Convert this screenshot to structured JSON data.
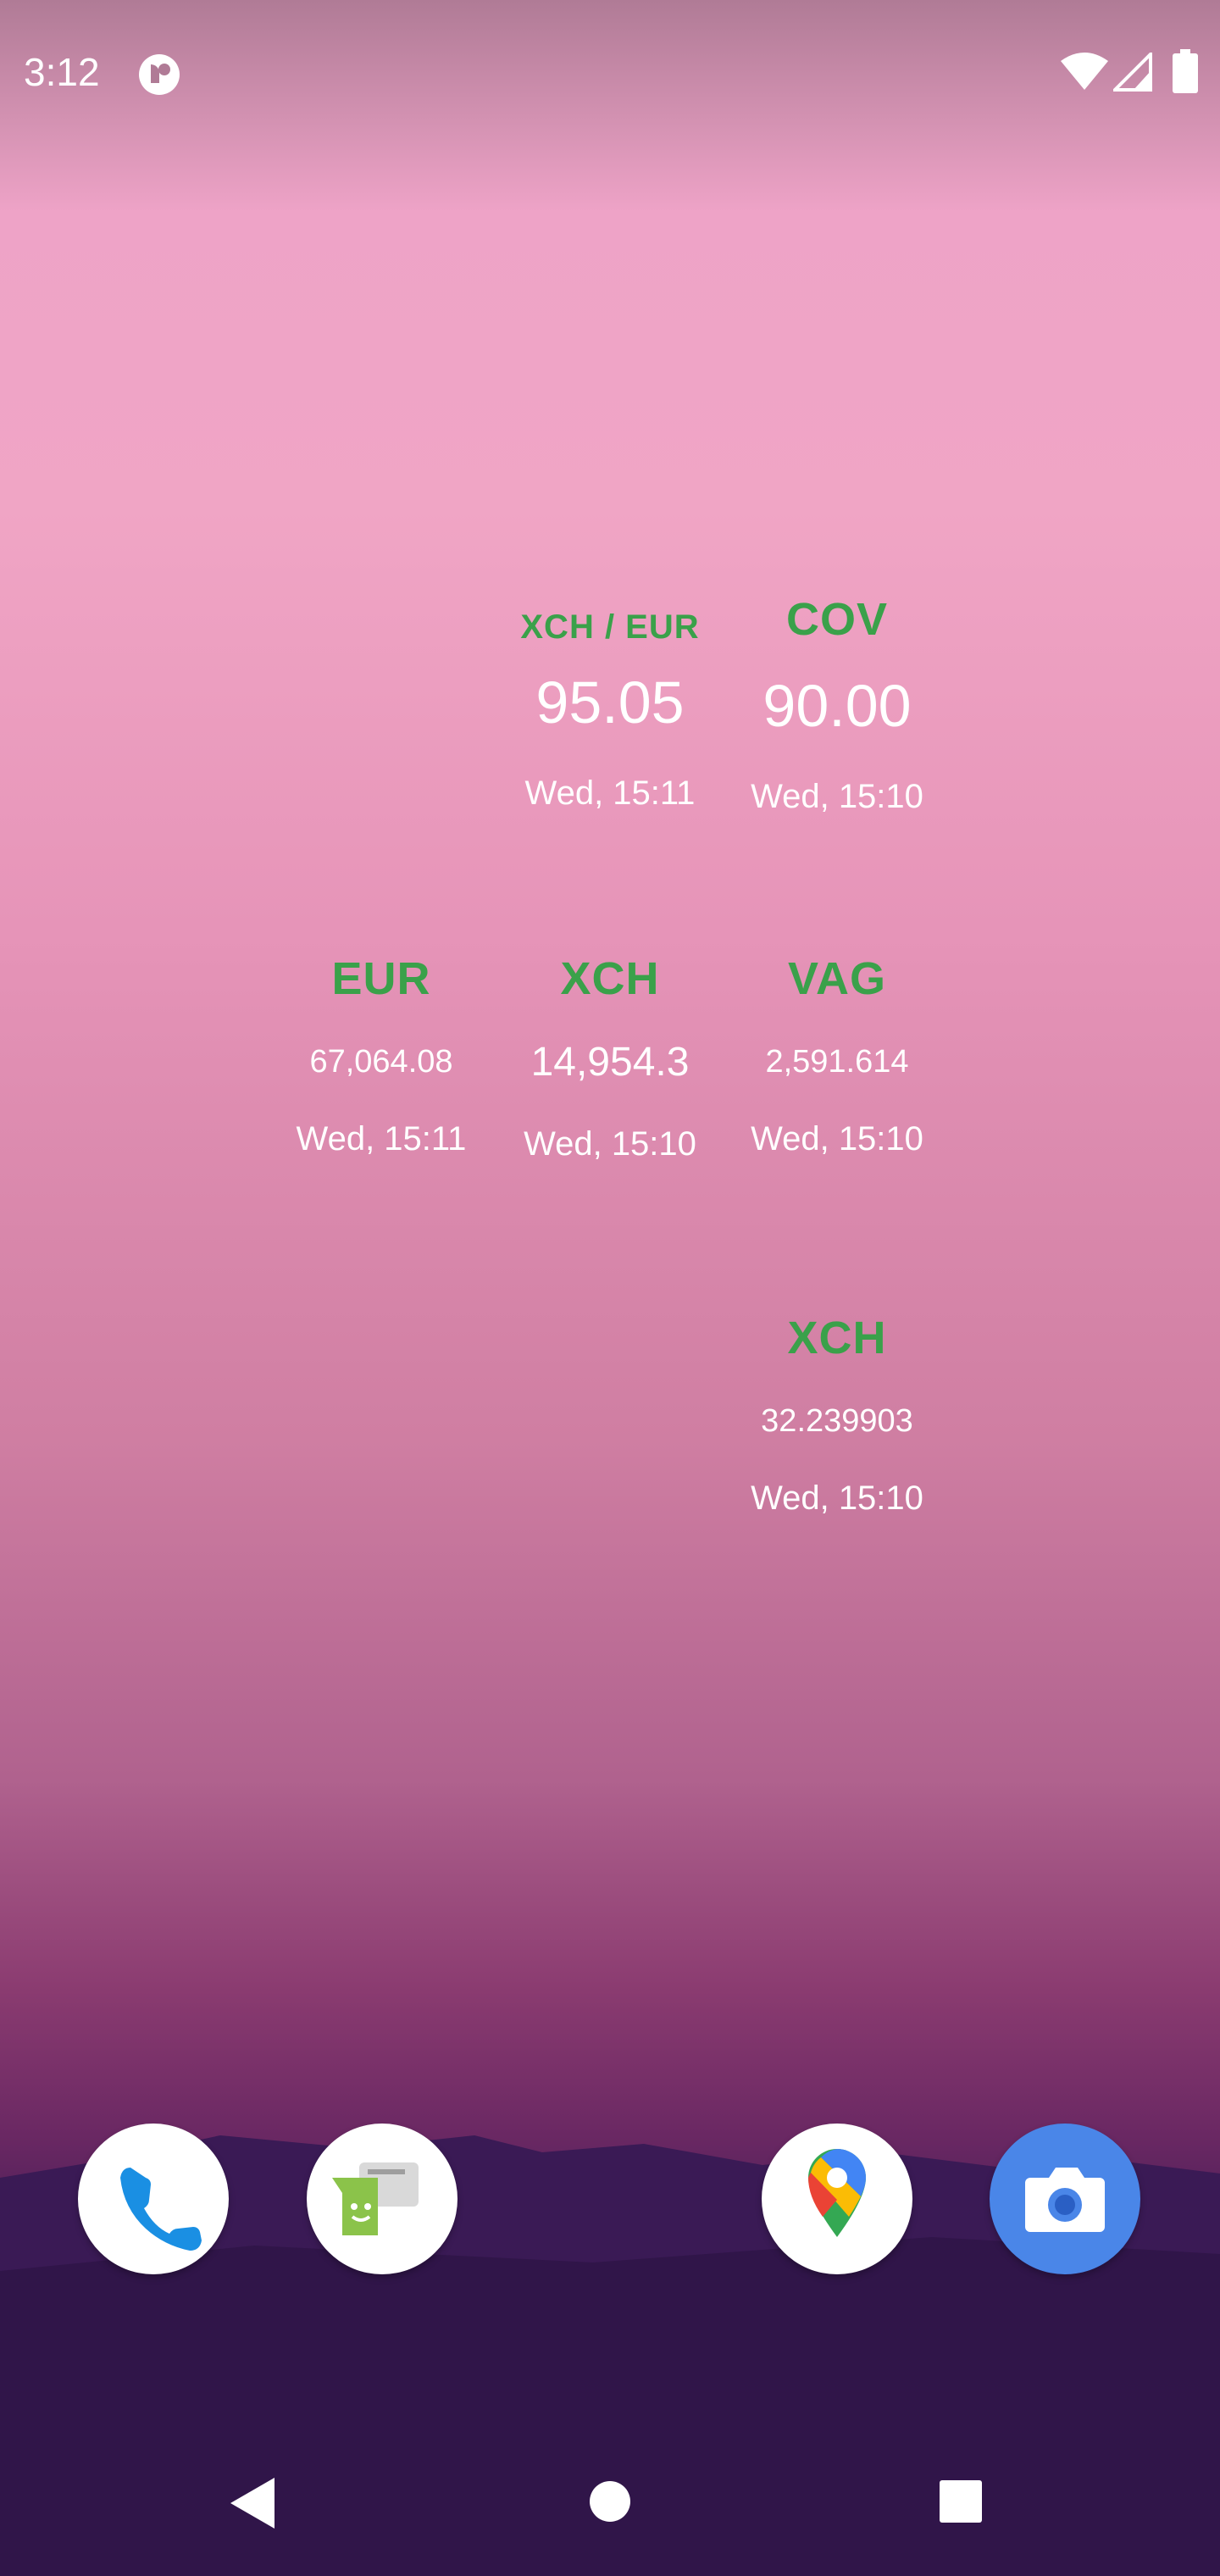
{
  "status_bar": {
    "time": "3:12",
    "icons": [
      "app-notification-icon",
      "wifi-icon",
      "cell-signal-icon",
      "battery-icon"
    ]
  },
  "widgets": {
    "row1": [
      {
        "ticker": "XCH / EUR",
        "price": "95.05",
        "stamp": "Wed, 15:11"
      },
      {
        "ticker": "COV",
        "price": "90.00",
        "stamp": "Wed, 15:10"
      }
    ],
    "row2": [
      {
        "ticker": "EUR",
        "price": "67,064.08",
        "stamp": "Wed, 15:11"
      },
      {
        "ticker": "XCH",
        "price": "14,954.3",
        "stamp": "Wed, 15:10"
      },
      {
        "ticker": "VAG",
        "price": "2,591.614",
        "stamp": "Wed, 15:10"
      }
    ],
    "row3": [
      {
        "ticker": "XCH",
        "price": "32.239903",
        "stamp": "Wed, 15:10"
      }
    ],
    "ticker_color": "#3aa14a"
  },
  "dock": {
    "apps": [
      "phone-icon",
      "messaging-icon",
      "maps-icon",
      "camera-icon"
    ]
  },
  "navigation": {
    "buttons": [
      "back-icon",
      "home-icon",
      "recents-icon"
    ]
  }
}
